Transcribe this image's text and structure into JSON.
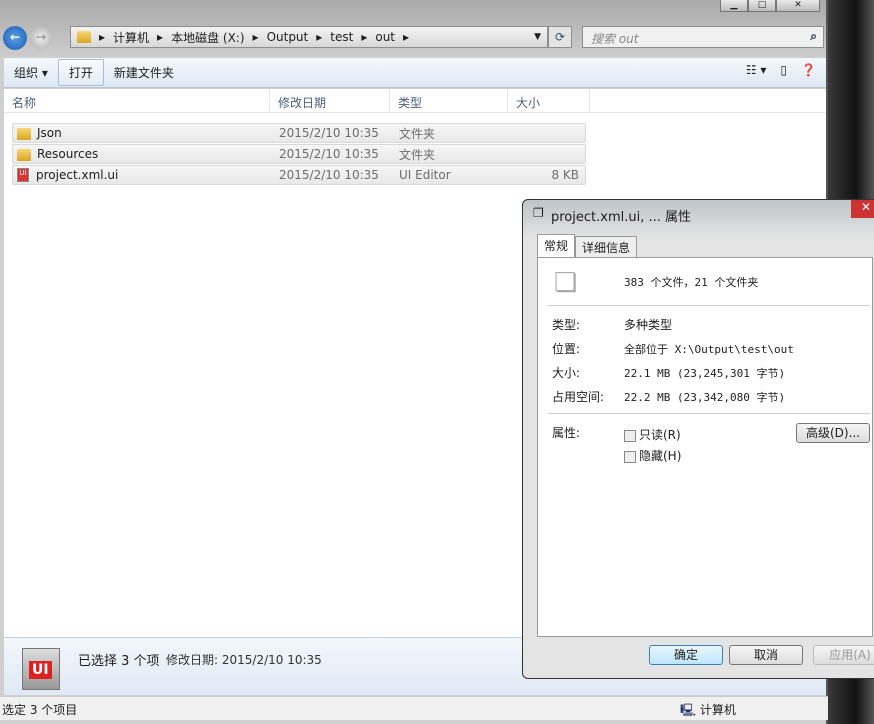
{
  "explorer": {
    "breadcrumb": [
      "计算机",
      "本地磁盘 (X:)",
      "Output",
      "test",
      "out"
    ],
    "search_placeholder": "搜索 out",
    "toolbar": {
      "organize": "组织 ▾",
      "open": "打开",
      "new_folder": "新建文件夹"
    },
    "columns": [
      "名称",
      "修改日期",
      "类型",
      "大小"
    ],
    "files": [
      {
        "name": "Json",
        "date": "2015/2/10 10:35",
        "type": "文件夹",
        "size": "",
        "icon": "folder"
      },
      {
        "name": "Resources",
        "date": "2015/2/10 10:35",
        "type": "文件夹",
        "size": "",
        "icon": "folder"
      },
      {
        "name": "project.xml.ui",
        "date": "2015/2/10 10:35",
        "type": "UI Editor",
        "size": "8 KB",
        "icon": "ui-file"
      }
    ],
    "details": {
      "selected": "已选择 3 个项",
      "modified": "修改日期: 2015/2/10 10:35",
      "icon_text": "UI"
    },
    "status": {
      "left": "选定 3 个项目",
      "right": "计算机"
    }
  },
  "dialog": {
    "title": "project.xml.ui, ... 属性",
    "tabs": [
      "常规",
      "详细信息"
    ],
    "summary": "383 个文件，21 个文件夹",
    "fields": [
      {
        "label": "类型:",
        "value": "多种类型"
      },
      {
        "label": "位置:",
        "value": "全部位于 X:\\Output\\test\\out"
      },
      {
        "label": "大小:",
        "value": "22.1 MB (23,245,301 字节)"
      },
      {
        "label": "占用空间:",
        "value": "22.2 MB (23,342,080 字节)"
      }
    ],
    "attr_label": "属性:",
    "readonly": "只读(R)",
    "hidden": "隐藏(H)",
    "advanced": "高级(D)...",
    "ok": "确定",
    "cancel": "取消",
    "apply": "应用(A)"
  }
}
